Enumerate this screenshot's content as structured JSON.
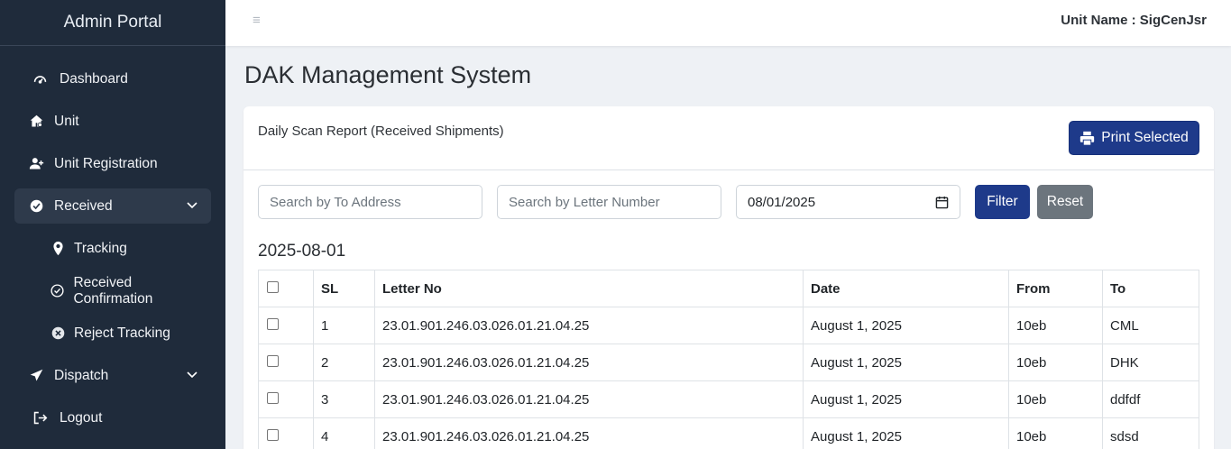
{
  "sidebar": {
    "brand": "Admin Portal",
    "items": [
      {
        "label": "Dashboard",
        "icon": "gauge-icon"
      },
      {
        "label": "Unit",
        "icon": "home-gear-icon"
      },
      {
        "label": "Unit Registration",
        "icon": "user-plus-icon"
      },
      {
        "label": "Received",
        "icon": "check-circle-icon",
        "active": true,
        "expanded": true
      },
      {
        "label": "Tracking",
        "icon": "map-pin-icon"
      },
      {
        "label": "Received Confirmation",
        "icon": "check-circle-outline-icon"
      },
      {
        "label": "Reject Tracking",
        "icon": "x-circle-icon"
      },
      {
        "label": "Dispatch",
        "icon": "send-icon"
      },
      {
        "label": "Logout",
        "icon": "logout-icon"
      }
    ]
  },
  "topbar": {
    "menu_icon": "hamburger-icon",
    "unit_name": "Unit Name : SigCenJsr"
  },
  "page": {
    "title": "DAK Management System"
  },
  "card": {
    "title": "Daily Scan Report (Received Shipments)",
    "print_label": "Print Selected"
  },
  "filters": {
    "to_address_placeholder": "Search by To Address",
    "letter_number_placeholder": "Search by Letter Number",
    "date_value": "08/01/2025",
    "filter_label": "Filter",
    "reset_label": "Reset"
  },
  "report": {
    "date_heading": "2025-08-01",
    "columns": [
      "SL",
      "Letter No",
      "Date",
      "From",
      "To"
    ],
    "rows": [
      [
        "1",
        "23.01.901.246.03.026.01.21.04.25",
        "August 1, 2025",
        "10eb",
        "CML"
      ],
      [
        "2",
        "23.01.901.246.03.026.01.21.04.25",
        "August 1, 2025",
        "10eb",
        "DHK"
      ],
      [
        "3",
        "23.01.901.246.03.026.01.21.04.25",
        "August 1, 2025",
        "10eb",
        "ddfdf"
      ],
      [
        "4",
        "23.01.901.246.03.026.01.21.04.25",
        "August 1, 2025",
        "10eb",
        "sdsd"
      ]
    ]
  },
  "colors": {
    "sidebar_bg": "#1f2b3b",
    "primary": "#1e3a8a",
    "secondary": "#6c757d"
  }
}
